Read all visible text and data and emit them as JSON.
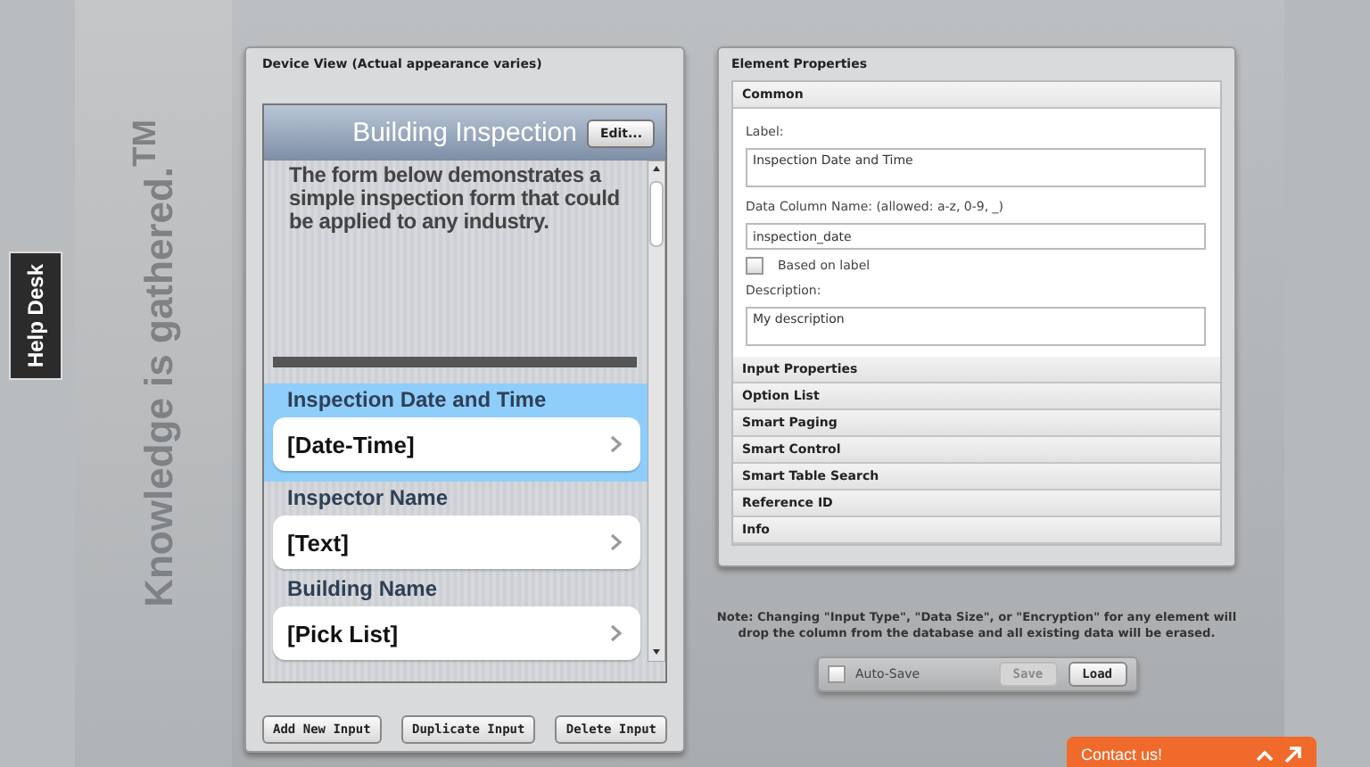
{
  "help_tab": {
    "label": "Help Desk"
  },
  "tagline": "Knowledge is gathered.$^{TM}$",
  "device_view": {
    "title": "Device View (Actual appearance varies)",
    "form_title": "Building Inspection",
    "edit_button": "Edit...",
    "intro": "The form below demonstrates a simple inspection form that could be applied to any industry.",
    "fields": [
      {
        "label": "Inspection Date and Time",
        "value": "[Date-Time]",
        "selected": true
      },
      {
        "label": "Inspector Name",
        "value": "[Text]",
        "selected": false
      },
      {
        "label": "Building Name",
        "value": "[Pick List]",
        "selected": false
      }
    ],
    "buttons": [
      "Add New Input",
      "Duplicate Input",
      "Delete Input"
    ]
  },
  "properties": {
    "title": "Element Properties",
    "sections": [
      {
        "label": "Common",
        "expanded": true,
        "label_field": {
          "label": "Label:",
          "value": "Inspection Date and Time"
        },
        "column_field": {
          "label": "Data Column Name: (allowed: a-z, 0-9, _)",
          "value": "inspection_date"
        },
        "based_on_label": {
          "label": "Based on label",
          "checked": false
        },
        "description": {
          "label": "Description:",
          "value": "My description"
        }
      },
      {
        "label": "Input Properties",
        "expanded": false
      },
      {
        "label": "Option List",
        "expanded": false
      },
      {
        "label": "Smart Paging",
        "expanded": false
      },
      {
        "label": "Smart Control",
        "expanded": false
      },
      {
        "label": "Smart Table Search",
        "expanded": false
      },
      {
        "label": "Reference ID",
        "expanded": false
      },
      {
        "label": "Info",
        "expanded": false
      }
    ]
  },
  "note": "Note: Changing \"Input Type\", \"Data Size\", or \"Encryption\" for any element will drop the  column from the database and all existing data will be erased.",
  "autosave": {
    "label": "Auto-Save",
    "checked": false
  },
  "save_button": {
    "label": "Save",
    "disabled": true
  },
  "load_button": {
    "label": "Load",
    "disabled": false
  },
  "contact": {
    "label": "Contact us!"
  }
}
